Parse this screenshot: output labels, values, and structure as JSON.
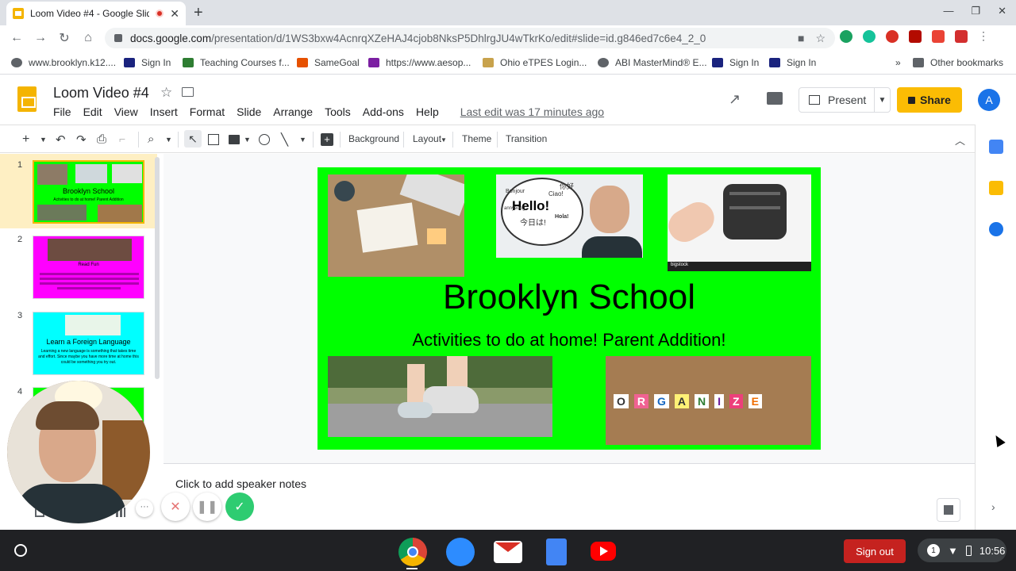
{
  "browser": {
    "tab_title": "Loom Video #4 - Google Slid",
    "url_host": "docs.google.com",
    "url_path": "/presentation/d/1WS3bxw4AcnrqXZeHAJ4cjob8NksP5DhlrgJU4wTkrKo/edit#slide=id.g846ed7c6e4_2_0",
    "bookmarks": [
      "www.brooklyn.k12....",
      "Sign In",
      "Teaching Courses f...",
      "SameGoal",
      "https://www.aesop...",
      "Ohio eTPES Login...",
      "ABI MasterMind® E...",
      "Sign In",
      "Sign In"
    ],
    "bookmarks_overflow": "»",
    "other_bookmarks": "Other bookmarks"
  },
  "app": {
    "doc_title": "Loom Video #4",
    "menus": [
      "File",
      "Edit",
      "View",
      "Insert",
      "Format",
      "Slide",
      "Arrange",
      "Tools",
      "Add-ons",
      "Help"
    ],
    "last_edit": "Last edit was 17 minutes ago",
    "present_label": "Present",
    "share_label": "Share",
    "avatar_letter": "A"
  },
  "toolbar": {
    "background": "Background",
    "layout": "Layout",
    "theme": "Theme",
    "transition": "Transition"
  },
  "filmstrip": {
    "slides": [
      {
        "num": "1",
        "title": "Brooklyn School",
        "subtitle": "Activities to do at home! Parent Addition",
        "bg": "#00ff00"
      },
      {
        "num": "2",
        "title": "Read Fun",
        "subtitle": "",
        "bg": "#ff00ff"
      },
      {
        "num": "3",
        "title": "Learn a Foreign Language",
        "subtitle": "Learning a new language is something that takes time and effort. Since maybe you have more time at home this could be something you try out.",
        "bg": "#00ffff"
      },
      {
        "num": "4",
        "title": "",
        "subtitle": "",
        "bg": "#00ff00"
      }
    ]
  },
  "slide": {
    "title": "Brooklyn School",
    "subtitle": "Activities to do at home! Parent Addition!",
    "bg": "#00ff00",
    "images": {
      "bubble_words": [
        "Bonjour",
        "你好",
        "Ciao!",
        "Hello!",
        "Hola!",
        "今日は!",
        "annyeong"
      ],
      "bubble_main": "Hello!",
      "organize_letters": [
        "O",
        "R",
        "G",
        "A",
        "N",
        "I",
        "Z",
        "E"
      ],
      "stock_label": "bigstock"
    }
  },
  "notes": {
    "placeholder": "Click to add speaker notes"
  },
  "shelf": {
    "signout": "Sign out",
    "notification_count": "1",
    "time": "10:56"
  }
}
